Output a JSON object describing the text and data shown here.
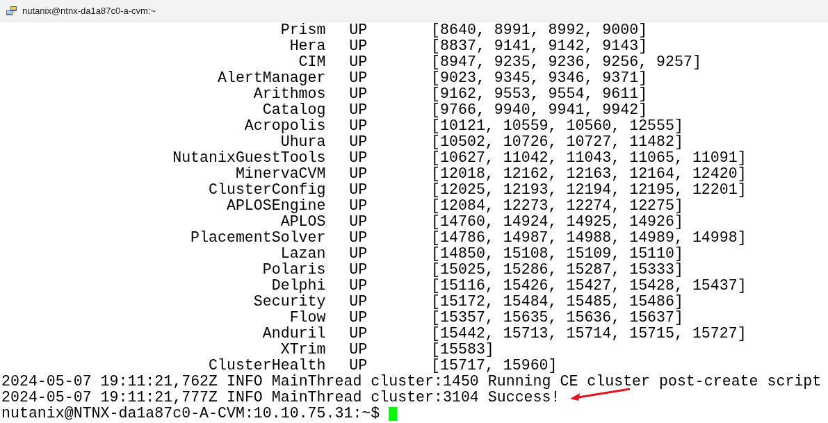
{
  "window": {
    "title": "nutanix@ntnx-da1a87c0-a-cvm:~"
  },
  "services": [
    {
      "name": "Prism",
      "status": "UP",
      "pids": "[8640, 8991, 8992, 9000]"
    },
    {
      "name": "Hera",
      "status": "UP",
      "pids": "[8837, 9141, 9142, 9143]"
    },
    {
      "name": "CIM",
      "status": "UP",
      "pids": "[8947, 9235, 9236, 9256, 9257]"
    },
    {
      "name": "AlertManager",
      "status": "UP",
      "pids": "[9023, 9345, 9346, 9371]"
    },
    {
      "name": "Arithmos",
      "status": "UP",
      "pids": "[9162, 9553, 9554, 9611]"
    },
    {
      "name": "Catalog",
      "status": "UP",
      "pids": "[9766, 9940, 9941, 9942]"
    },
    {
      "name": "Acropolis",
      "status": "UP",
      "pids": "[10121, 10559, 10560, 12555]"
    },
    {
      "name": "Uhura",
      "status": "UP",
      "pids": "[10502, 10726, 10727, 11482]"
    },
    {
      "name": "NutanixGuestTools",
      "status": "UP",
      "pids": "[10627, 11042, 11043, 11065, 11091]"
    },
    {
      "name": "MinervaCVM",
      "status": "UP",
      "pids": "[12018, 12162, 12163, 12164, 12420]"
    },
    {
      "name": "ClusterConfig",
      "status": "UP",
      "pids": "[12025, 12193, 12194, 12195, 12201]"
    },
    {
      "name": "APLOSEngine",
      "status": "UP",
      "pids": "[12084, 12273, 12274, 12275]"
    },
    {
      "name": "APLOS",
      "status": "UP",
      "pids": "[14760, 14924, 14925, 14926]"
    },
    {
      "name": "PlacementSolver",
      "status": "UP",
      "pids": "[14786, 14987, 14988, 14989, 14998]"
    },
    {
      "name": "Lazan",
      "status": "UP",
      "pids": "[14850, 15108, 15109, 15110]"
    },
    {
      "name": "Polaris",
      "status": "UP",
      "pids": "[15025, 15286, 15287, 15333]"
    },
    {
      "name": "Delphi",
      "status": "UP",
      "pids": "[15116, 15426, 15427, 15428, 15437]"
    },
    {
      "name": "Security",
      "status": "UP",
      "pids": "[15172, 15484, 15485, 15486]"
    },
    {
      "name": "Flow",
      "status": "UP",
      "pids": "[15357, 15635, 15636, 15637]"
    },
    {
      "name": "Anduril",
      "status": "UP",
      "pids": "[15442, 15713, 15714, 15715, 15727]"
    },
    {
      "name": "XTrim",
      "status": "UP",
      "pids": "[15583]"
    },
    {
      "name": "ClusterHealth",
      "status": "UP",
      "pids": "[15717, 15960]"
    }
  ],
  "log_lines": [
    "2024-05-07 19:11:21,762Z INFO MainThread cluster:1450 Running CE cluster post-create script",
    "2024-05-07 19:11:21,777Z INFO MainThread cluster:3104 Success!"
  ],
  "prompt": "nutanix@NTNX-da1a87c0-A-CVM:10.10.75.31:~$"
}
